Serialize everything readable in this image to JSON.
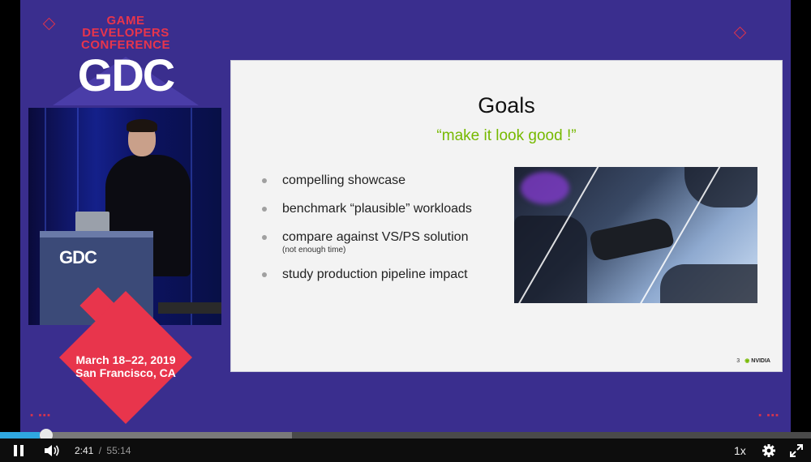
{
  "conference": {
    "line1": "GAME",
    "line2": "DEVELOPERS",
    "line3": "CONFERENCE",
    "logo": "GDC",
    "podium_logo": "GDC",
    "date_line1": "March 18–22, 2019",
    "date_line2": "San Francisco, CA"
  },
  "slide": {
    "title": "Goals",
    "subtitle": "“make it look good !”",
    "bullets": [
      {
        "text": "compelling showcase",
        "note": ""
      },
      {
        "text": "benchmark “plausible” workloads",
        "note": ""
      },
      {
        "text": "compare against VS/PS solution",
        "note": "(not enough time)"
      },
      {
        "text": "study production pipeline impact",
        "note": ""
      }
    ],
    "page_number": "3",
    "brand": "NVIDIA"
  },
  "player": {
    "current_time": "2:41",
    "separator": "/",
    "duration": "55:14",
    "played_fraction": 0.049,
    "buffered_fraction": 0.36,
    "speed": "1x",
    "icons": {
      "play_pause": "pause-icon",
      "volume": "volume-icon",
      "settings": "gear-icon",
      "fullscreen": "fullscreen-icon"
    }
  },
  "colors": {
    "background": "#3a2e8e",
    "accent_red": "#e8354c",
    "nvidia_green": "#76b900",
    "progress_blue": "#2fa7e0"
  }
}
